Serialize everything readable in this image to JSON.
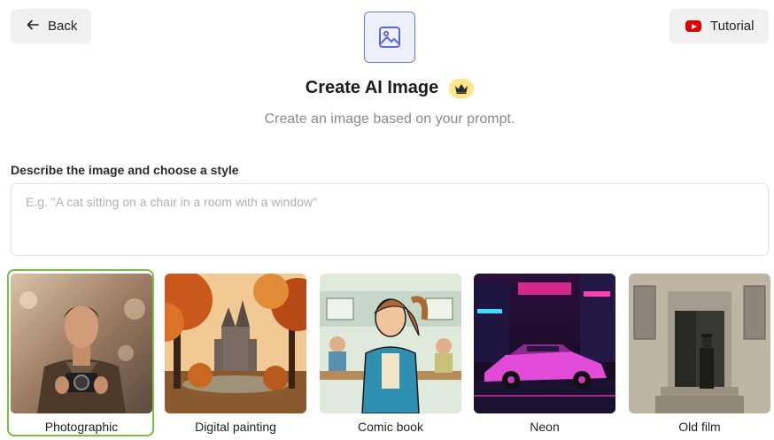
{
  "header": {
    "back_label": "Back",
    "tutorial_label": "Tutorial",
    "hero_icon": "image-icon",
    "tutorial_icon": "youtube-icon"
  },
  "title": {
    "text": "Create AI Image",
    "badge_icon": "crown-icon",
    "subtitle": "Create an image based on your prompt."
  },
  "prompt": {
    "label": "Describe the image and choose a style",
    "placeholder": "E.g. \"A cat sitting on a chair in a room with a window\"",
    "value": ""
  },
  "styles": [
    {
      "label": "Photographic",
      "selected": true
    },
    {
      "label": "Digital painting",
      "selected": false
    },
    {
      "label": "Comic book",
      "selected": false
    },
    {
      "label": "Neon",
      "selected": false
    },
    {
      "label": "Old film",
      "selected": false
    }
  ],
  "colors": {
    "accent": "#6f79e0",
    "selected_border": "#74c146",
    "crown_bg": "#fde58a",
    "youtube_red": "#e00000"
  }
}
